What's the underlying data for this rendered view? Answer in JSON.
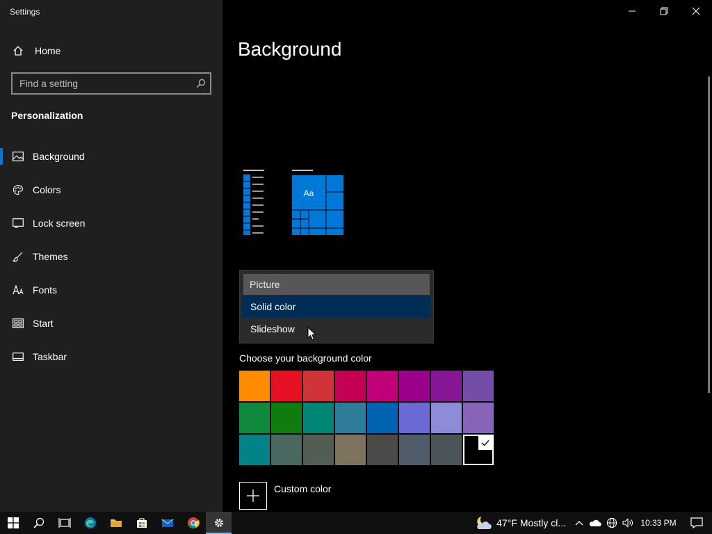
{
  "app": {
    "title": "Settings"
  },
  "sidebar": {
    "home_label": "Home",
    "search_placeholder": "Find a setting",
    "section_title": "Personalization",
    "items": [
      {
        "label": "Background",
        "icon": "picture-icon",
        "active": true
      },
      {
        "label": "Colors",
        "icon": "palette-icon",
        "active": false
      },
      {
        "label": "Lock screen",
        "icon": "lock-screen-icon",
        "active": false
      },
      {
        "label": "Themes",
        "icon": "brush-icon",
        "active": false
      },
      {
        "label": "Fonts",
        "icon": "font-icon",
        "active": false
      },
      {
        "label": "Start",
        "icon": "start-icon",
        "active": false
      },
      {
        "label": "Taskbar",
        "icon": "taskbar-icon",
        "active": false
      }
    ]
  },
  "main": {
    "title": "Background",
    "preview": {
      "tile_text": "Aa"
    },
    "dropdown": {
      "options": [
        "Picture",
        "Solid color",
        "Slideshow"
      ],
      "highlighted": "Solid color"
    },
    "swatch_label": "Choose your background color",
    "custom_color_label": "Custom color",
    "swatches": [
      "#ff8c00",
      "#e81123",
      "#d13438",
      "#c30052",
      "#bf0077",
      "#9a0089",
      "#881798",
      "#744da9",
      "#10893e",
      "#107c10",
      "#018574",
      "#2d7d9a",
      "#0063b1",
      "#6b69d6",
      "#8e8cd8",
      "#8764b8",
      "#038387",
      "#486860",
      "#525e54",
      "#7e735f",
      "#4c4a48",
      "#515c6b",
      "#4a5459",
      "#000000"
    ],
    "selected_swatch": 23
  },
  "taskbar": {
    "weather_temp": "47°F",
    "weather_text": "Mostly cl...",
    "time": "10:33 PM"
  },
  "colors": {
    "accent": "#0078d7",
    "sidebar_bg": "#1f1f1f"
  }
}
